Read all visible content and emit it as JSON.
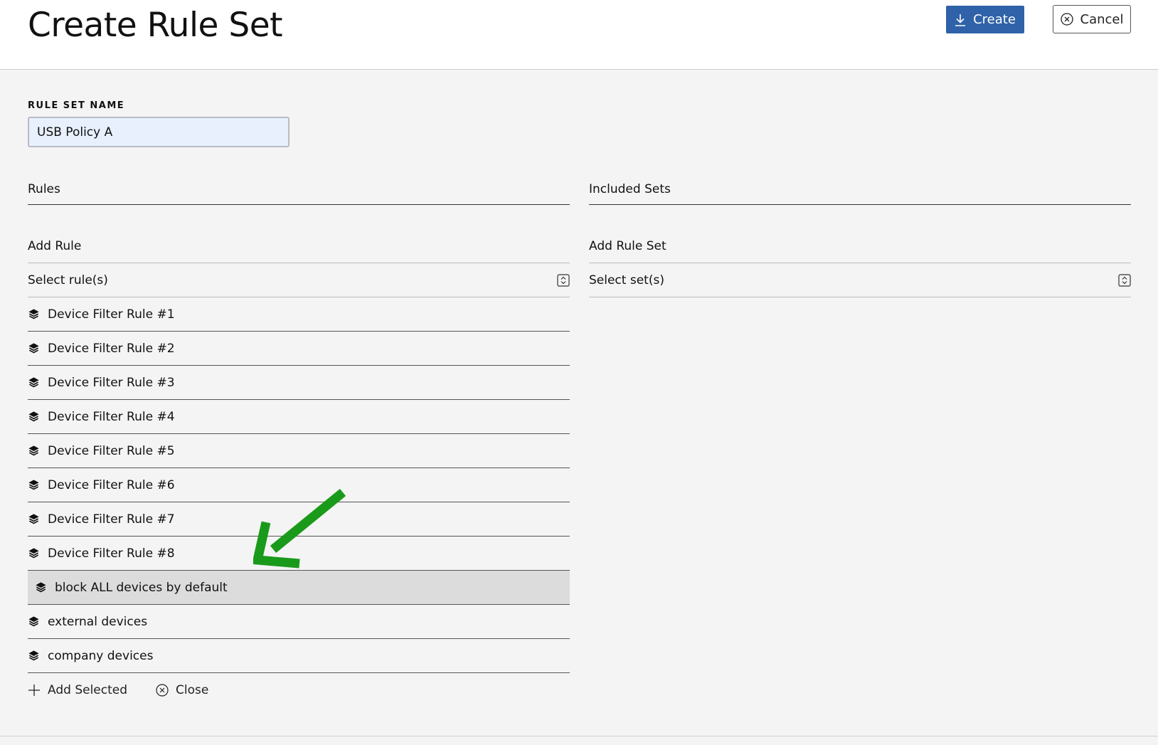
{
  "header": {
    "title": "Create Rule Set",
    "create_label": "Create",
    "cancel_label": "Cancel"
  },
  "form": {
    "rule_set_name_label": "RULE SET NAME",
    "rule_set_name_value": "USB Policy A"
  },
  "rules": {
    "heading": "Rules",
    "add_heading": "Add Rule",
    "select_placeholder": "Select rule(s)",
    "items": [
      {
        "label": "Device Filter Rule #1",
        "selected": false
      },
      {
        "label": "Device Filter Rule #2",
        "selected": false
      },
      {
        "label": "Device Filter Rule #3",
        "selected": false
      },
      {
        "label": "Device Filter Rule #4",
        "selected": false
      },
      {
        "label": "Device Filter Rule #5",
        "selected": false
      },
      {
        "label": "Device Filter Rule #6",
        "selected": false
      },
      {
        "label": "Device Filter Rule #7",
        "selected": false
      },
      {
        "label": "Device Filter Rule #8",
        "selected": false
      },
      {
        "label": "block ALL devices by default",
        "selected": true
      },
      {
        "label": "external devices",
        "selected": false
      },
      {
        "label": "company devices",
        "selected": false
      }
    ],
    "add_selected_label": "Add Selected",
    "close_label": "Close"
  },
  "included_sets": {
    "heading": "Included Sets",
    "add_heading": "Add Rule Set",
    "select_placeholder": "Select set(s)"
  },
  "colors": {
    "primary": "#2f62a8",
    "annotation_arrow": "#1a9a1a",
    "selected_row": "#dcdcdc",
    "input_bg": "#e8f0fe"
  }
}
